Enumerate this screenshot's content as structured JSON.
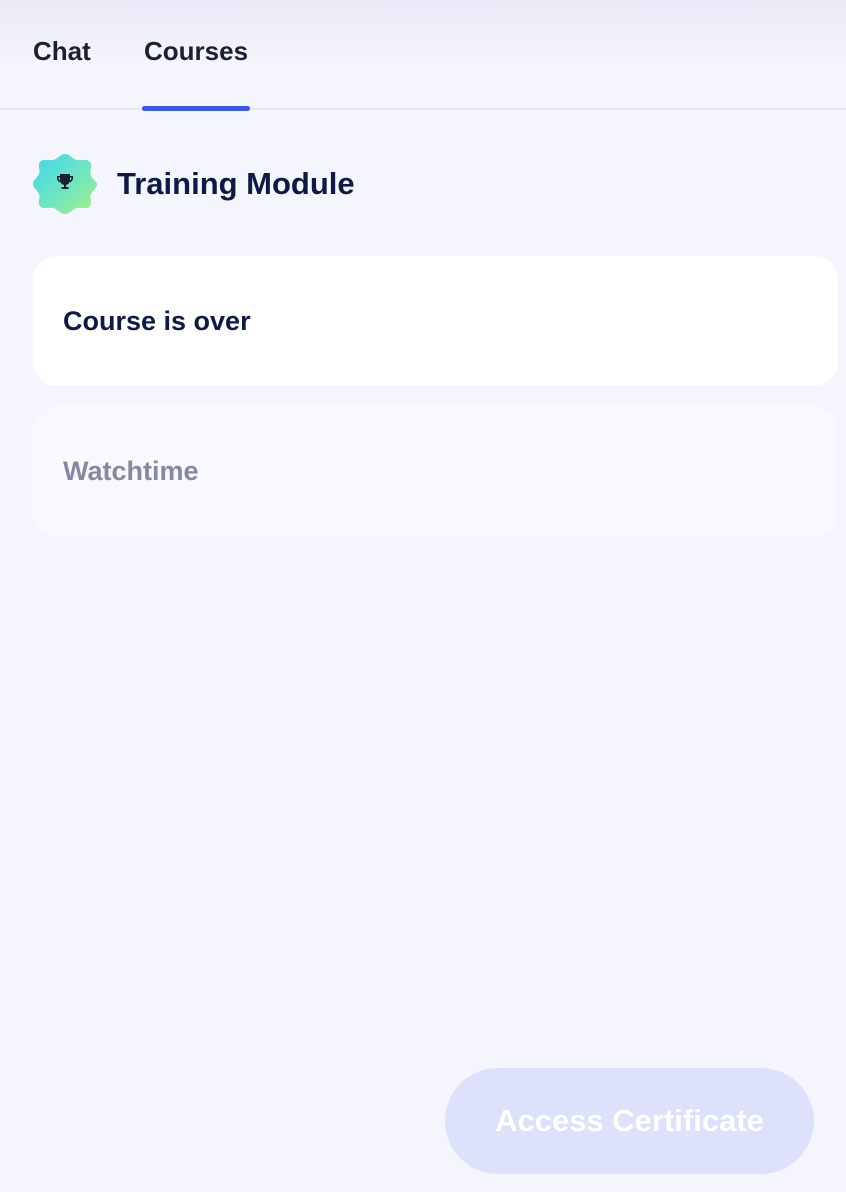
{
  "tabs": [
    {
      "label": "Chat",
      "active": false
    },
    {
      "label": "Courses",
      "active": true
    }
  ],
  "accent_color": "#3657f0",
  "module": {
    "icon": "trophy-icon",
    "title": "Training Module"
  },
  "cards": {
    "status": "Course is over",
    "watchtime_label": "Watchtime"
  },
  "certificate_button": {
    "label": "Access Certificate",
    "disabled": true
  }
}
